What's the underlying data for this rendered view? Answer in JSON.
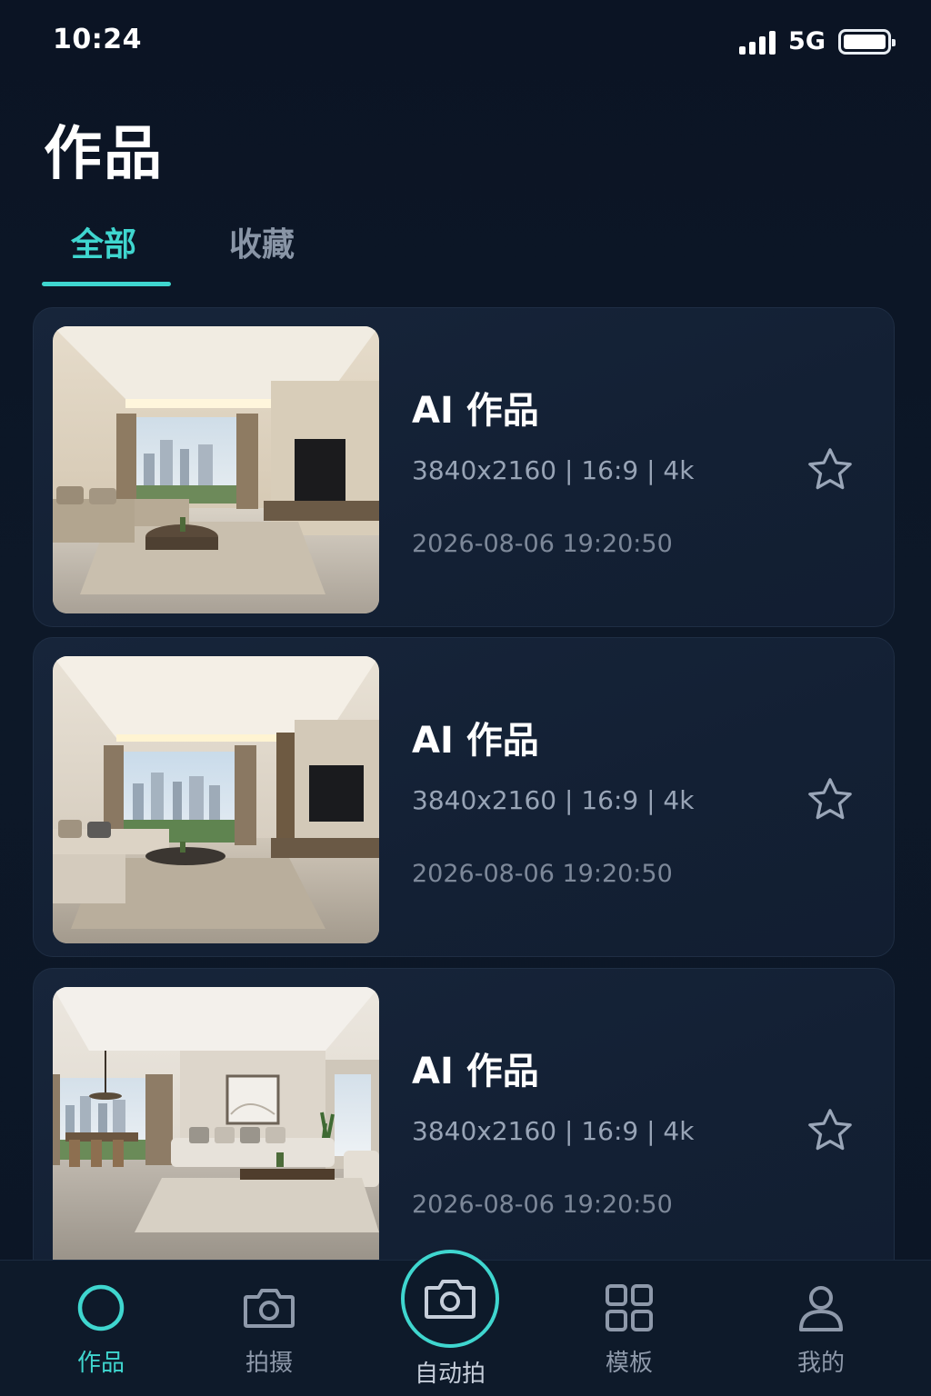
{
  "status_bar": {
    "time": "10:24",
    "network": "5G",
    "signal_bars": 4,
    "battery_level": 1.0
  },
  "page": {
    "title": "作品"
  },
  "tabs": [
    {
      "label": "全部",
      "active": true
    },
    {
      "label": "收藏",
      "active": false
    }
  ],
  "items": [
    {
      "title": "AI 作品",
      "specs": "3840x2160 | 16:9 | 4k",
      "date": "2026-08-06 19:20:50",
      "favorited": false
    },
    {
      "title": "AI 作品",
      "specs": "3840x2160 | 16:9 | 4k",
      "date": "2026-08-06 19:20:50",
      "favorited": false
    },
    {
      "title": "AI 作品",
      "specs": "3840x2160 | 16:9 | 4k",
      "date": "2026-08-06 19:20:50",
      "favorited": false
    }
  ],
  "bottom_nav": {
    "items": [
      {
        "label": "作品",
        "icon": "circle-icon",
        "active": true
      },
      {
        "label": "拍摄",
        "icon": "camera-icon",
        "active": false
      },
      {
        "label": "自动拍",
        "icon": "camera-icon",
        "active": false
      },
      {
        "label": "模板",
        "icon": "grid-icon",
        "active": false
      },
      {
        "label": "我的",
        "icon": "user-icon",
        "active": false
      }
    ]
  },
  "colors": {
    "accent": "#3fd6cf",
    "background": "#0b1424",
    "card": "#152236",
    "muted_text": "#98a4b6"
  }
}
